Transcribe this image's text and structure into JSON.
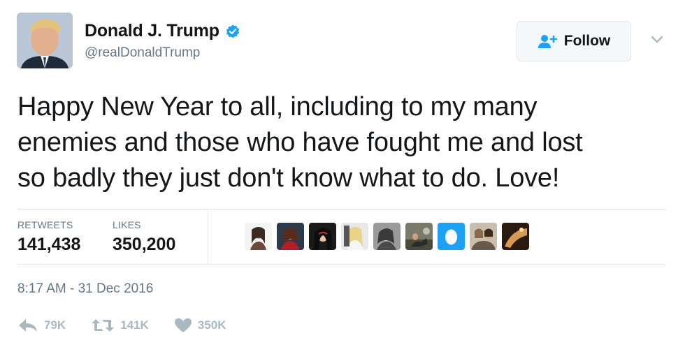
{
  "author": {
    "display_name": "Donald J. Trump",
    "handle": "@realDonaldTrump",
    "verified": true
  },
  "follow_button": {
    "label": "Follow"
  },
  "tweet": {
    "text": "Happy New Year to all, including to my many\nenemies and those who have fought me and lost\nso badly they just don't know what to do. Love!",
    "timestamp": "8:17 AM - 31 Dec 2016"
  },
  "stats": {
    "retweets_label": "RETWEETS",
    "retweets_value": "141,438",
    "likes_label": "LIKES",
    "likes_value": "350,200"
  },
  "likers_count": 9,
  "actions": {
    "reply_count": "79K",
    "retweet_count": "141K",
    "like_count": "350K"
  },
  "colors": {
    "accent": "#1da1f2",
    "text": "#14171a",
    "secondary": "#657786",
    "action": "#aab8c2",
    "border": "#e1e8ed"
  }
}
